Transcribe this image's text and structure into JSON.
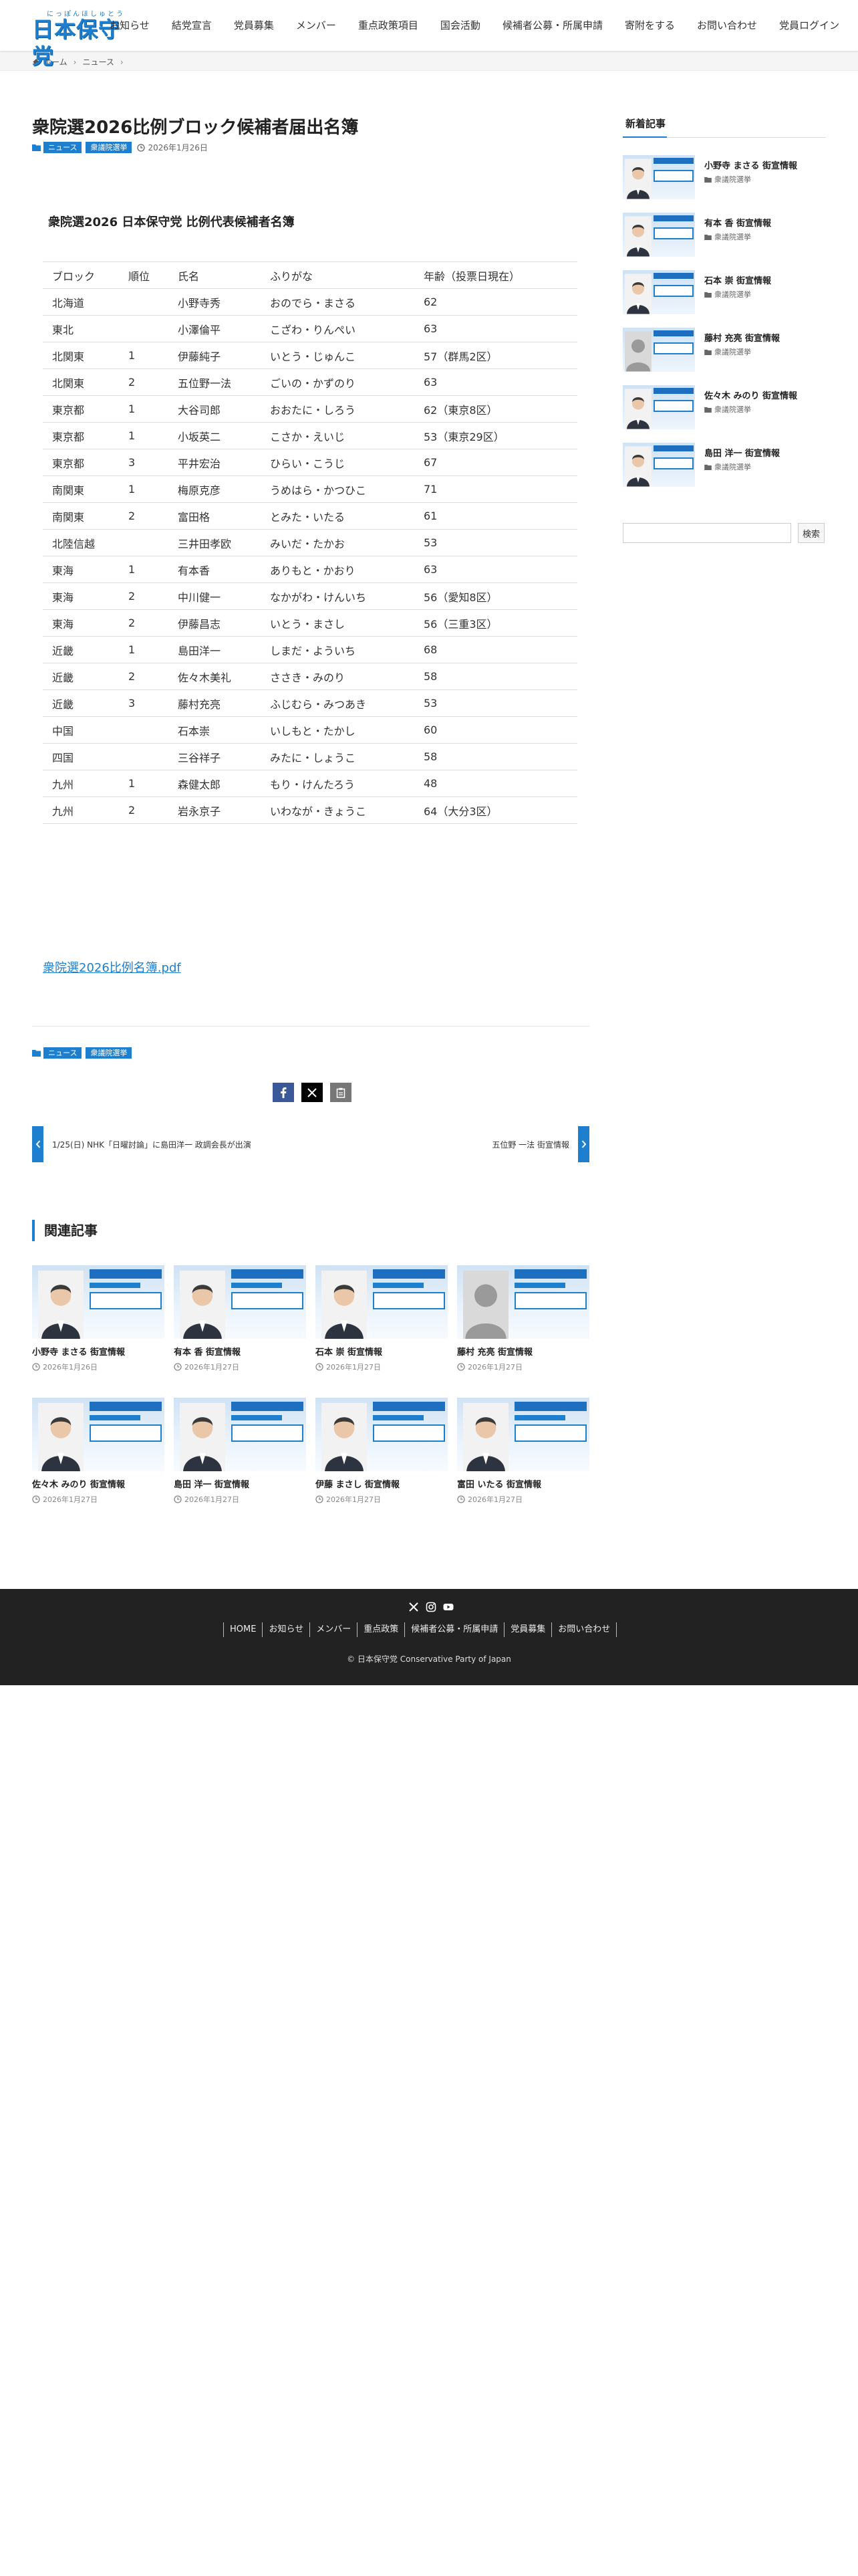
{
  "site": {
    "logo_kana": "にっぽんほしゅとう",
    "logo_text": "日本保守党",
    "nav": [
      "お知らせ",
      "結党宣言",
      "党員募集",
      "メンバー",
      "重点政策項目",
      "国会活動",
      "候補者公募・所属申請",
      "寄附をする",
      "お問い合わせ",
      "党員ログイン"
    ]
  },
  "breadcrumb": {
    "home": "ホーム",
    "current": "ニュース"
  },
  "article": {
    "title": "衆院選2026比例ブロック候補者届出名簿",
    "categories": [
      "ニュース",
      "衆議院選挙"
    ],
    "date": "2026年1月26日",
    "table_title": "衆院選2026 日本保守党 比例代表候補者名簿",
    "table_header": [
      "ブロック",
      "順位",
      "氏名",
      "ふりがな",
      "年齢（投票日現在）"
    ],
    "rows": [
      [
        "北海道",
        "",
        "小野寺秀",
        "おのでら・まさる",
        "62"
      ],
      [
        "東北",
        "",
        "小澤倫平",
        "こざわ・りんぺい",
        "63"
      ],
      [
        "北関東",
        "1",
        "伊藤純子",
        "いとう・じゅんこ",
        "57（群馬2区）"
      ],
      [
        "北関東",
        "2",
        "五位野一法",
        "ごいの・かずのり",
        "63"
      ],
      [
        "東京都",
        "1",
        "大谷司郎",
        "おおたに・しろう",
        "62（東京8区）"
      ],
      [
        "東京都",
        "1",
        "小坂英二",
        "こさか・えいじ",
        "53（東京29区）"
      ],
      [
        "東京都",
        "3",
        "平井宏治",
        "ひらい・こうじ",
        "67"
      ],
      [
        "南関東",
        "1",
        "梅原克彦",
        "うめはら・かつひこ",
        "71"
      ],
      [
        "南関東",
        "2",
        "富田格",
        "とみた・いたる",
        "61"
      ],
      [
        "北陸信越",
        "",
        "三井田孝欧",
        "みいだ・たかお",
        "53"
      ],
      [
        "東海",
        "1",
        "有本香",
        "ありもと・かおり",
        "63"
      ],
      [
        "東海",
        "2",
        "中川健一",
        "なかがわ・けんいち",
        "56（愛知8区）"
      ],
      [
        "東海",
        "2",
        "伊藤昌志",
        "いとう・まさし",
        "56（三重3区）"
      ],
      [
        "近畿",
        "1",
        "島田洋一",
        "しまだ・よういち",
        "68"
      ],
      [
        "近畿",
        "2",
        "佐々木美礼",
        "ささき・みのり",
        "58"
      ],
      [
        "近畿",
        "3",
        "藤村充亮",
        "ふじむら・みつあき",
        "53"
      ],
      [
        "中国",
        "",
        "石本崇",
        "いしもと・たかし",
        "60"
      ],
      [
        "四国",
        "",
        "三谷祥子",
        "みたに・しょうこ",
        "58"
      ],
      [
        "九州",
        "1",
        "森健太郎",
        "もり・けんたろう",
        "48"
      ],
      [
        "九州",
        "2",
        "岩永京子",
        "いわなが・きょうこ",
        "64（大分3区）"
      ]
    ],
    "pdf_link": "衆院選2026比例名簿.pdf"
  },
  "share": {
    "facebook_icon": "facebook-icon",
    "x_icon": "x-icon",
    "copy_icon": "copy-icon"
  },
  "post_nav": {
    "prev": "1/25(日) NHK「日曜討論」に島田洋一 政調会長が出演",
    "next": "五位野 一法 街宣情報"
  },
  "related": {
    "title": "関連記事",
    "items": [
      {
        "name": "小野寺 まさる 街宣情報",
        "date": "2026年1月26日",
        "photo": "person"
      },
      {
        "name": "有本 香 街宣情報",
        "date": "2026年1月27日",
        "photo": "person"
      },
      {
        "name": "石本 崇 街宣情報",
        "date": "2026年1月27日",
        "photo": "person"
      },
      {
        "name": "藤村 充亮 街宣情報",
        "date": "2026年1月27日",
        "photo": "silhouette"
      },
      {
        "name": "佐々木 みのり 街宣情報",
        "date": "2026年1月27日",
        "photo": "person"
      },
      {
        "name": "島田 洋一 街宣情報",
        "date": "2026年1月27日",
        "photo": "person"
      },
      {
        "name": "伊藤 まさし 街宣情報",
        "date": "2026年1月27日",
        "photo": "person"
      },
      {
        "name": "富田 いたる 街宣情報",
        "date": "2026年1月27日",
        "photo": "person"
      }
    ]
  },
  "sidebar": {
    "title": "新着記事",
    "items": [
      {
        "name": "小野寺 まさる 街宣情報",
        "category": "衆議院選挙",
        "photo": "person"
      },
      {
        "name": "有本 香 街宣情報",
        "category": "衆議院選挙",
        "photo": "person"
      },
      {
        "name": "石本 崇 街宣情報",
        "category": "衆議院選挙",
        "photo": "person"
      },
      {
        "name": "藤村 充亮 街宣情報",
        "category": "衆議院選挙",
        "photo": "silhouette"
      },
      {
        "name": "佐々木 みのり 街宣情報",
        "category": "衆議院選挙",
        "photo": "person"
      },
      {
        "name": "島田 洋一 街宣情報",
        "category": "衆議院選挙",
        "photo": "person"
      }
    ],
    "search_button": "検索"
  },
  "footer": {
    "social_icons": [
      "x-icon",
      "instagram-icon",
      "youtube-icon"
    ],
    "nav": [
      "HOME",
      "お知らせ",
      "メンバー",
      "重点政策",
      "候補者公募・所属申請",
      "党員募集",
      "お問い合わせ"
    ],
    "copyright": "© 日本保守党 Conservative Party of Japan"
  },
  "colors": {
    "accent": "#1e7fce",
    "footer_bg": "#222222",
    "link": "#1e7fce"
  }
}
